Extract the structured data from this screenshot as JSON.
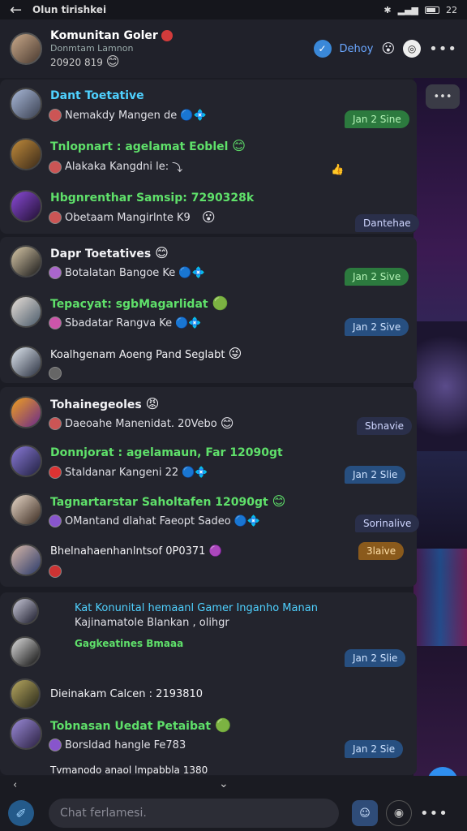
{
  "status": {
    "title": "Olun tirishkei",
    "time": "22"
  },
  "header": {
    "name": "Komunitan Goler",
    "subtitle": "Donmtam Lamnon",
    "meta": "20920 819",
    "link": "Dehoy",
    "menu_icon": "more-icon"
  },
  "messages": [
    {
      "name": "Dant Toetative",
      "text": "Nemakdy Mangen de",
      "tag": "Jan 2 Sine",
      "tag_color": "green"
    },
    {
      "name": "Tnlopnart : agelamat Eoblel",
      "text": "Alakaka Kangdni le:",
      "tag": "",
      "tag_color": ""
    },
    {
      "name": "Hbgnrenthar Samsip: 7290328k",
      "text": "Obetaam Mangirlnte K9",
      "tag": "Dantehae",
      "tag_color": "dark"
    },
    {
      "name": "Dapr Toetatives",
      "text": "Botalatan Bangoe Ke",
      "tag": "Jan 2 Sive",
      "tag_color": "green"
    },
    {
      "name": "Tepacyat: sgbMagarlidat",
      "text": "Sbadatar Rangva Ke",
      "tag": "Jan 2 Sive",
      "tag_color": "blue"
    },
    {
      "name": "Koalhgenam Aoeng Pand Seglabt",
      "text": "",
      "tag": "",
      "tag_color": ""
    },
    {
      "name": "Tohainegeoles",
      "text": "Daeoahe Manenidat. 20Vebo",
      "tag": "Sbnavie",
      "tag_color": "dark"
    },
    {
      "name": "Donnjorat : agelamaun, Far 12090gt",
      "text": "Staldanar Kangeni 22",
      "tag": "Jan 2 Slie",
      "tag_color": "blue"
    },
    {
      "name": "Tagnartarstar Saholtafen 12090gt",
      "text": "OMantand dlahat Faeopt Sadeo",
      "tag": "Sorinalive",
      "tag_color": "dark"
    },
    {
      "name": "Bhelnahaenhanlntsof 0P0371",
      "text": "",
      "tag": "3laive",
      "tag_color": "gold"
    },
    {
      "name": "Kat Konunital hemaanl Gamer Inganho Manan",
      "text": "Kajinamatole Blankan , olihgr",
      "tag": "",
      "tag_color": ""
    },
    {
      "name": "Gagkeatines Bmaaa",
      "text": "",
      "tag": "Jan 2 Slie",
      "tag_color": "blue"
    },
    {
      "name": "Dieinakam Calcen : 2193810",
      "text": "",
      "tag": "",
      "tag_color": ""
    },
    {
      "name": "Tobnasan Uedat Petaibat",
      "text": "Borsldad hangle Fe783",
      "tag": "Jan 2 Sie",
      "tag_color": "blue"
    },
    {
      "name": "Tvmanodo anaol lmpabbla 1380",
      "text": "",
      "tag": "",
      "tag_color": ""
    }
  ],
  "compose": {
    "placeholder": "Chat ferlamesi."
  },
  "colors": {
    "accent": "#2f8ff0",
    "green": "#5fe06a",
    "cyan": "#4fd1ff"
  }
}
